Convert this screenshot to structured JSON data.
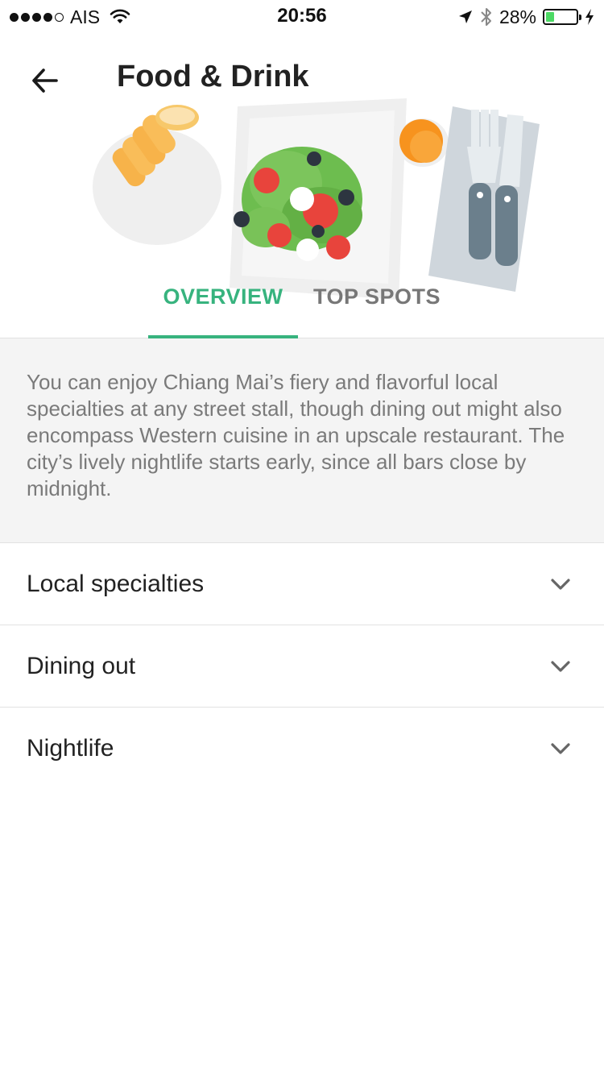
{
  "status_bar": {
    "carrier": "AIS",
    "time": "20:56",
    "battery_percent": "28%",
    "battery_level": 0.28,
    "icons": [
      "signal-dots-icon",
      "wifi-icon",
      "location-arrow-icon",
      "bluetooth-icon",
      "battery-icon",
      "charging-bolt-icon"
    ]
  },
  "header": {
    "title": "Food & Drink",
    "back_icon": "arrow-left-icon"
  },
  "tabs": [
    {
      "label": "OVERVIEW",
      "active": true
    },
    {
      "label": "TOP SPOTS",
      "active": false
    }
  ],
  "overview": {
    "text": "You can enjoy Chiang Mai’s fiery and flavorful local specialties at any street stall, though dining out might also encompass Western cuisine in an upscale restaurant. The city’s lively nightlife starts early, since all bars close by midnight."
  },
  "sections": [
    {
      "label": "Local specialties",
      "icon": "chevron-down-icon"
    },
    {
      "label": "Dining out",
      "icon": "chevron-down-icon"
    },
    {
      "label": "Nightlife",
      "icon": "chevron-down-icon"
    }
  ],
  "colors": {
    "accent": "#37b37e",
    "overview_bg": "#f4f4f4",
    "divider": "#e2e2e2",
    "battery": "#4cd964"
  }
}
